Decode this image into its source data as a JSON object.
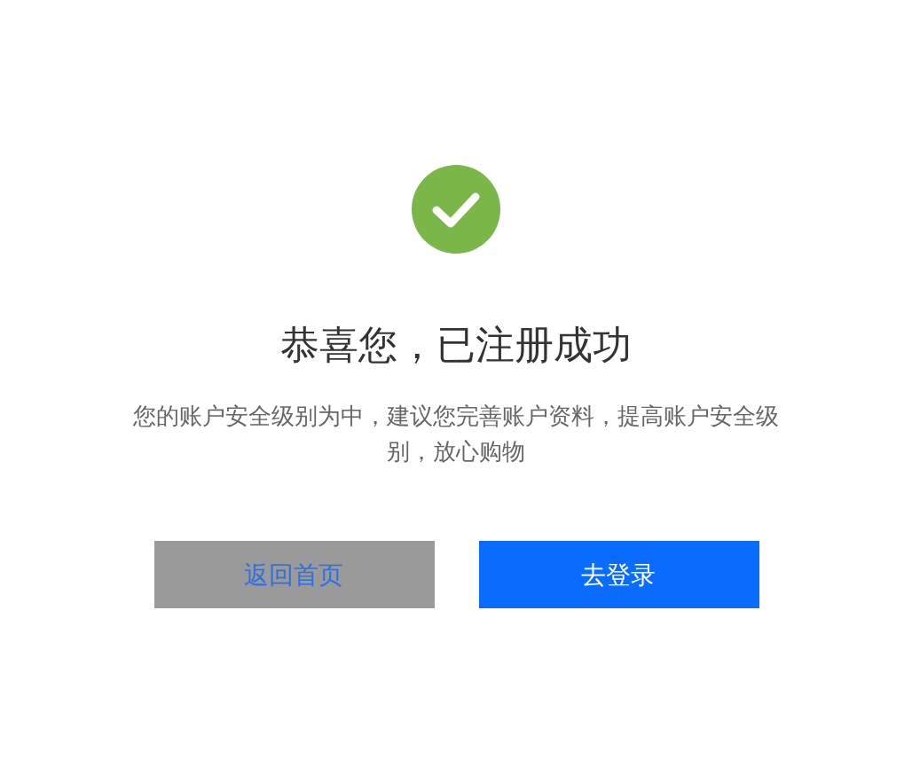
{
  "title": "恭喜您，已注册成功",
  "message": "您的账户安全级别为中，建议您完善账户资料，提高账户安全级别，放心购物",
  "buttons": [
    {
      "label": "返回首页",
      "kind": "secondary"
    },
    {
      "label": "去登录",
      "kind": "primary"
    }
  ]
}
